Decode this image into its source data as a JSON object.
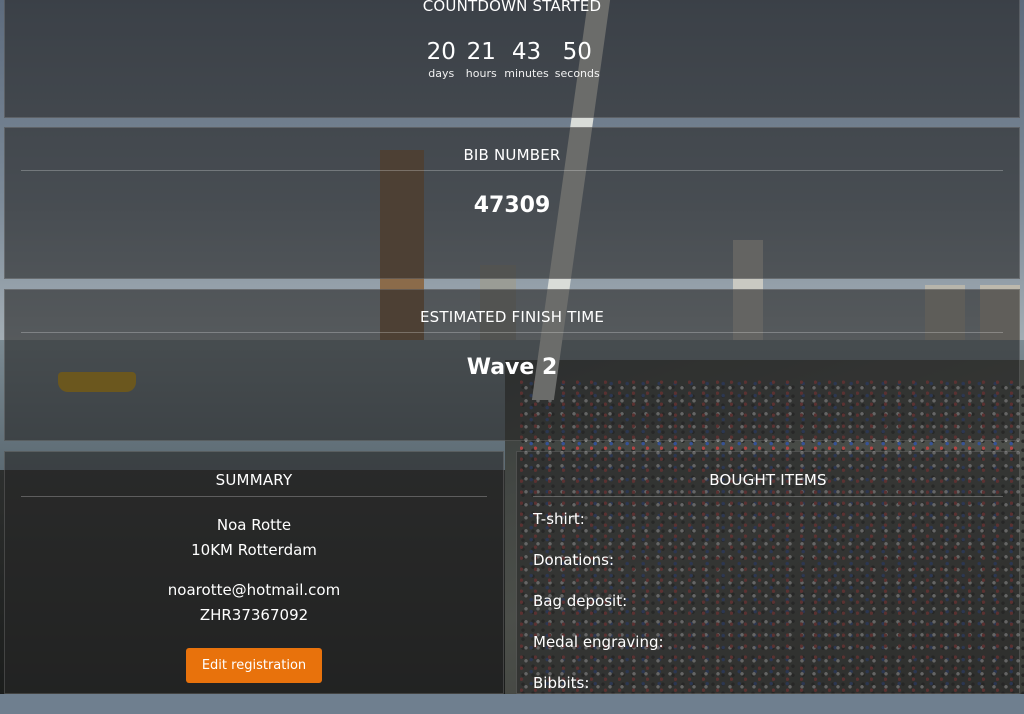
{
  "countdown": {
    "title": "COUNTDOWN STARTED",
    "units": [
      {
        "value": "20",
        "label": "days"
      },
      {
        "value": "21",
        "label": "hours"
      },
      {
        "value": "43",
        "label": "minutes"
      },
      {
        "value": "50",
        "label": "seconds"
      }
    ]
  },
  "bib": {
    "title": "BIB NUMBER",
    "value": "47309"
  },
  "finish": {
    "title": "ESTIMATED FINISH TIME",
    "value": "Wave 2"
  },
  "summary": {
    "title": "SUMMARY",
    "name": "Noa Rotte",
    "event": "10KM Rotterdam",
    "email": "noarotte@hotmail.com",
    "code": "ZHR37367092",
    "edit_label": "Edit registration"
  },
  "bought": {
    "title": "BOUGHT ITEMS",
    "items": [
      {
        "label": "T-shirt:"
      },
      {
        "label": "Donations:"
      },
      {
        "label": "Bag deposit:"
      },
      {
        "label": "Medal engraving:"
      },
      {
        "label": "Bibbits:"
      }
    ]
  },
  "colors": {
    "accent": "#e8720c",
    "panel": "rgba(38,38,38,0.62)"
  }
}
